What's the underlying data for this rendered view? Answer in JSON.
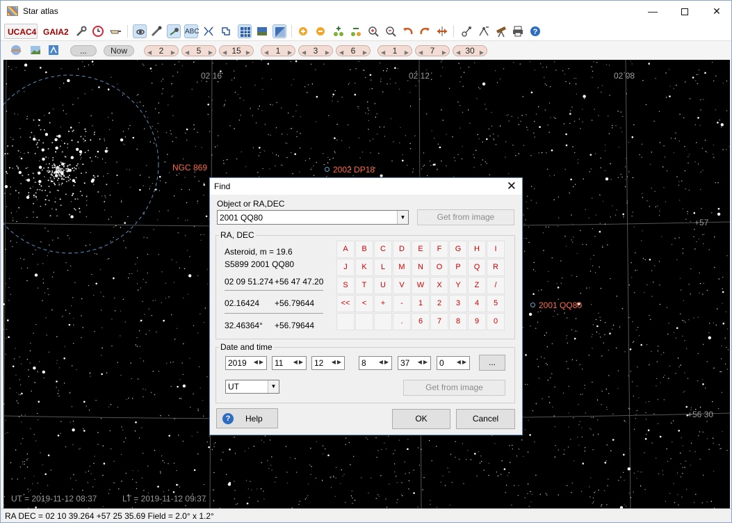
{
  "window": {
    "title": "Star atlas",
    "controls": {
      "minimize": "—",
      "close": "✕"
    }
  },
  "toolbar1": {
    "catalogs": [
      "UCAC4",
      "GAIA2"
    ],
    "icons": [
      "wrench-icon",
      "clock-icon",
      "pointing-hand-icon",
      "galaxy-icon",
      "comet-icon",
      "asteroid-icon",
      "label-abc-icon",
      "constellation-lines-icon",
      "constellation-boundaries-icon",
      "grid-icon",
      "horizon-icon",
      "milky-way-icon",
      "zoom-in-icon",
      "zoom-out-icon",
      "add-object-icon",
      "remove-object-icon",
      "magnify-plus-icon",
      "magnify-minus-icon",
      "undo-icon",
      "redo-icon",
      "flip-icon",
      "satellite-icon",
      "telescope-network-icon",
      "telescope-icon",
      "print-icon",
      "help-icon"
    ]
  },
  "toolbar2": {
    "icons": [
      "planet-icon",
      "landscape-icon",
      "compass-icon"
    ],
    "ellipsis_label": "...",
    "now_label": "Now",
    "steps": [
      "2",
      "5",
      "15",
      "1",
      "3",
      "6",
      "1",
      "7",
      "30"
    ]
  },
  "sky": {
    "ra_labels": [
      "02 16",
      "02 12",
      "02 08"
    ],
    "dec_labels": [
      "+57",
      "+56 30"
    ],
    "objects": [
      {
        "name": "NGC 869",
        "kind": "cluster"
      },
      {
        "name": "2002 DP18",
        "kind": "asteroid"
      },
      {
        "name": "2001 QQ80",
        "kind": "asteroid"
      }
    ],
    "ut": "UT = 2019-11-12  08:37",
    "lt": "LT = 2019-11-12  09:37"
  },
  "status": {
    "text": "RA DEC  =  02 10 39.264  +57 25 35.69  Field  =  2.0° x 1.2°"
  },
  "find_dialog": {
    "title": "Find",
    "close": "✕",
    "object_label": "Object or RA,DEC",
    "object_value": "2001  QQ80",
    "get_from_image": "Get from image",
    "radec_group": "RA, DEC",
    "info": {
      "type_line": "Asteroid,  m = 19.6",
      "id_line": "S5899 2001 QQ80",
      "sexagesimal_ra": "02 09 51.274",
      "sexagesimal_dec": "+56 47 47.20",
      "hours_ra": "02.16424",
      "hours_dec": "+56.79644",
      "degrees_ra": "32.46364°",
      "degrees_dec": "+56.79644"
    },
    "keypad": [
      [
        "A",
        "B",
        "C",
        "D",
        "E",
        "F",
        "G",
        "H",
        "I"
      ],
      [
        "J",
        "K",
        "L",
        "M",
        "N",
        "O",
        "P",
        "Q",
        "R"
      ],
      [
        "S",
        "T",
        "U",
        "V",
        "W",
        "X",
        "Y",
        "Z",
        "/"
      ],
      [
        "<<",
        "<",
        "+",
        "-",
        "1",
        "2",
        "3",
        "4",
        "5"
      ],
      [
        "",
        "",
        "",
        ".",
        "6",
        "7",
        "8",
        "9",
        "0"
      ]
    ],
    "datetime_group": "Date and time",
    "year": "2019",
    "month": "11",
    "day": "12",
    "hour": "8",
    "minute": "37",
    "second": "0",
    "more_label": "...",
    "timezone": "UT",
    "get_from_image_2": "Get from image",
    "help_label": "Help",
    "ok_label": "OK",
    "cancel_label": "Cancel"
  }
}
